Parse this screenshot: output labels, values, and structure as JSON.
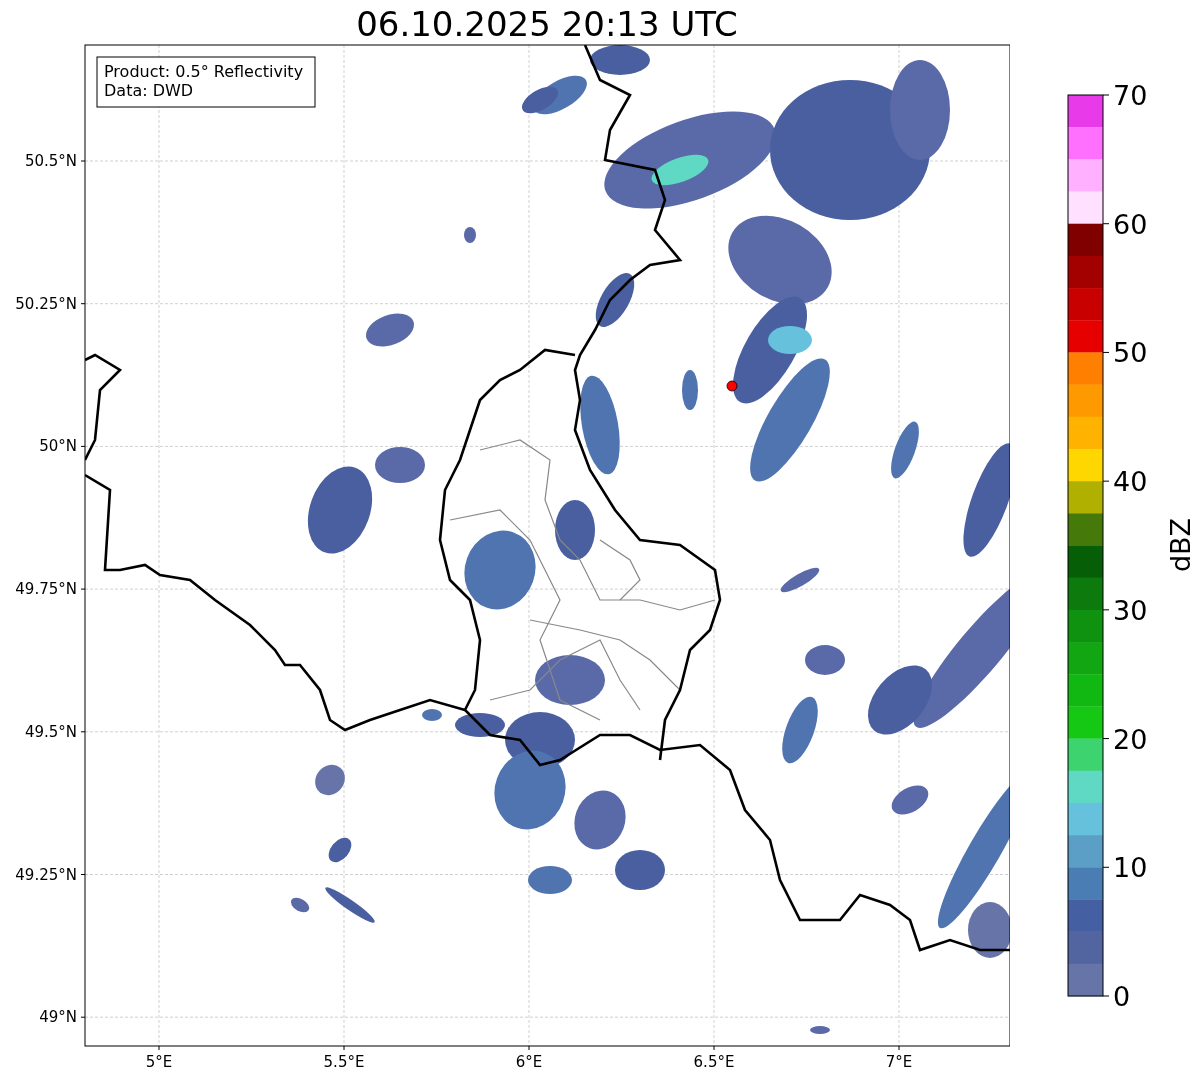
{
  "title": "06.10.2025 20:13 UTC",
  "map": {
    "info_lines": [
      "Product: 0.5° Reflectivity",
      "Data: DWD"
    ],
    "lat_ticks": [
      "50.5°N",
      "50.25°N",
      "50°N",
      "49.75°N",
      "49.5°N",
      "49.25°N",
      "49°N"
    ],
    "lon_ticks": [
      "5°E",
      "5.5°E",
      "6°E",
      "6.5°E",
      "7°E"
    ]
  },
  "colorbar": {
    "label": "dBZ",
    "ticks": [
      "70",
      "60",
      "50",
      "40",
      "30",
      "20",
      "10",
      "0"
    ],
    "bins": [
      {
        "color": "#e83ae8"
      },
      {
        "color": "#ff70ff"
      },
      {
        "color": "#ffb0ff"
      },
      {
        "color": "#ffe0ff"
      },
      {
        "color": "#800000"
      },
      {
        "color": "#a30000"
      },
      {
        "color": "#c80000"
      },
      {
        "color": "#e60000"
      },
      {
        "color": "#ff7f00"
      },
      {
        "color": "#ff9900"
      },
      {
        "color": "#ffb300"
      },
      {
        "color": "#ffd700"
      },
      {
        "color": "#b0b000"
      },
      {
        "color": "#457a0a"
      },
      {
        "color": "#065f06"
      },
      {
        "color": "#0c7a0c"
      },
      {
        "color": "#0f920f"
      },
      {
        "color": "#12a612"
      },
      {
        "color": "#12b812"
      },
      {
        "color": "#14c814"
      },
      {
        "color": "#3dd46f"
      },
      {
        "color": "#5fd8c4"
      },
      {
        "color": "#66c2dc"
      },
      {
        "color": "#5b9ec6"
      },
      {
        "color": "#4a7db3"
      },
      {
        "color": "#4460a2"
      },
      {
        "color": "#5365a0"
      },
      {
        "color": "#6674a8"
      }
    ]
  }
}
